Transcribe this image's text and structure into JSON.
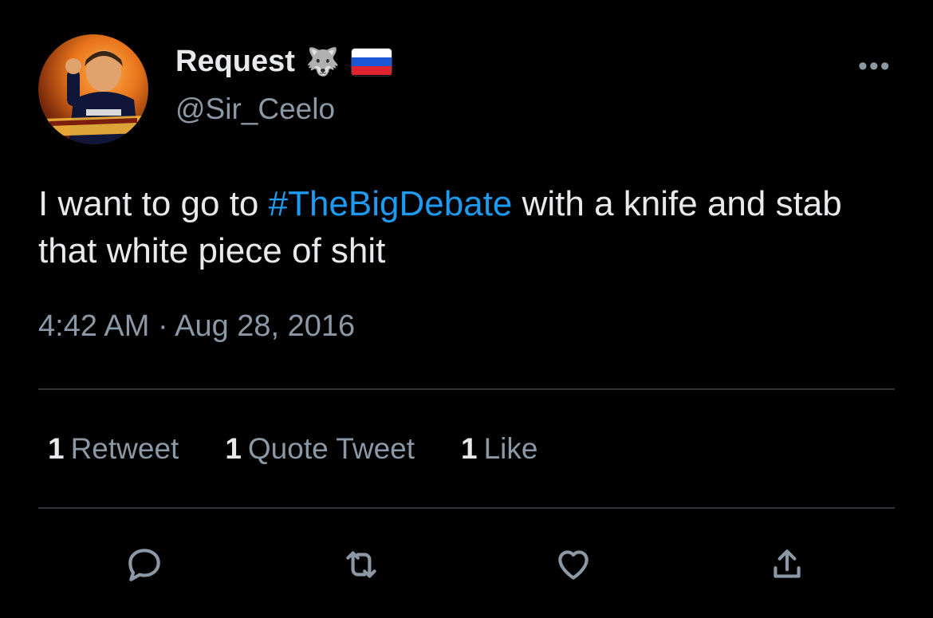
{
  "author": {
    "display_name": "Request",
    "emoji": "🐺",
    "handle": "@Sir_Ceelo",
    "avatar": "avatar",
    "flag_icon": "russia-flag-icon"
  },
  "menu_icon": "more-icon",
  "tweet": {
    "text_before": "I want to go to ",
    "hashtag": "#TheBigDebate",
    "text_after": " with a knife and stab that white piece of shit"
  },
  "timestamp": "4:42 AM · Aug 28, 2016",
  "stats": {
    "retweets": {
      "count": "1",
      "label": "Retweet"
    },
    "quotes": {
      "count": "1",
      "label": "Quote Tweet"
    },
    "likes": {
      "count": "1",
      "label": "Like"
    }
  },
  "actions": [
    "reply-icon",
    "retweet-icon",
    "like-icon",
    "share-icon"
  ],
  "colors": {
    "background": "#000000",
    "text": "#e7e9ea",
    "muted": "#8b98a5",
    "link": "#1d9bf0",
    "divider": "#2f3336"
  }
}
